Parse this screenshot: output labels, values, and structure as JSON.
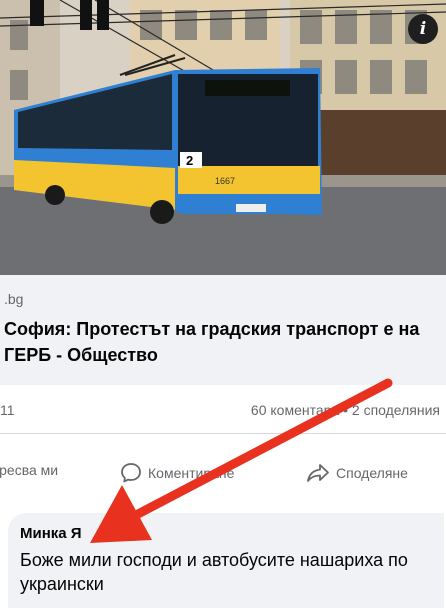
{
  "photo": {
    "route_number": "2",
    "fleet_number": "1667",
    "info_icon": "info-icon"
  },
  "preview": {
    "domain": ".bg",
    "headline": "София: Протестът на градския транспорт е на ГЕРБ - Общество"
  },
  "stats": {
    "likes": "11",
    "counts": "60 коментара • 2 споделяния"
  },
  "actions": {
    "like_label": "Харесва ми",
    "comment_label": "Коментиране",
    "share_label": "Споделяне"
  },
  "comment": {
    "author": "Минка Я",
    "text": "Боже мили господи и автобусите нашариха по украински"
  },
  "colors": {
    "arrow": "#e8321f",
    "bus_blue": "#2f7fd2",
    "bus_yellow": "#f4c430"
  }
}
